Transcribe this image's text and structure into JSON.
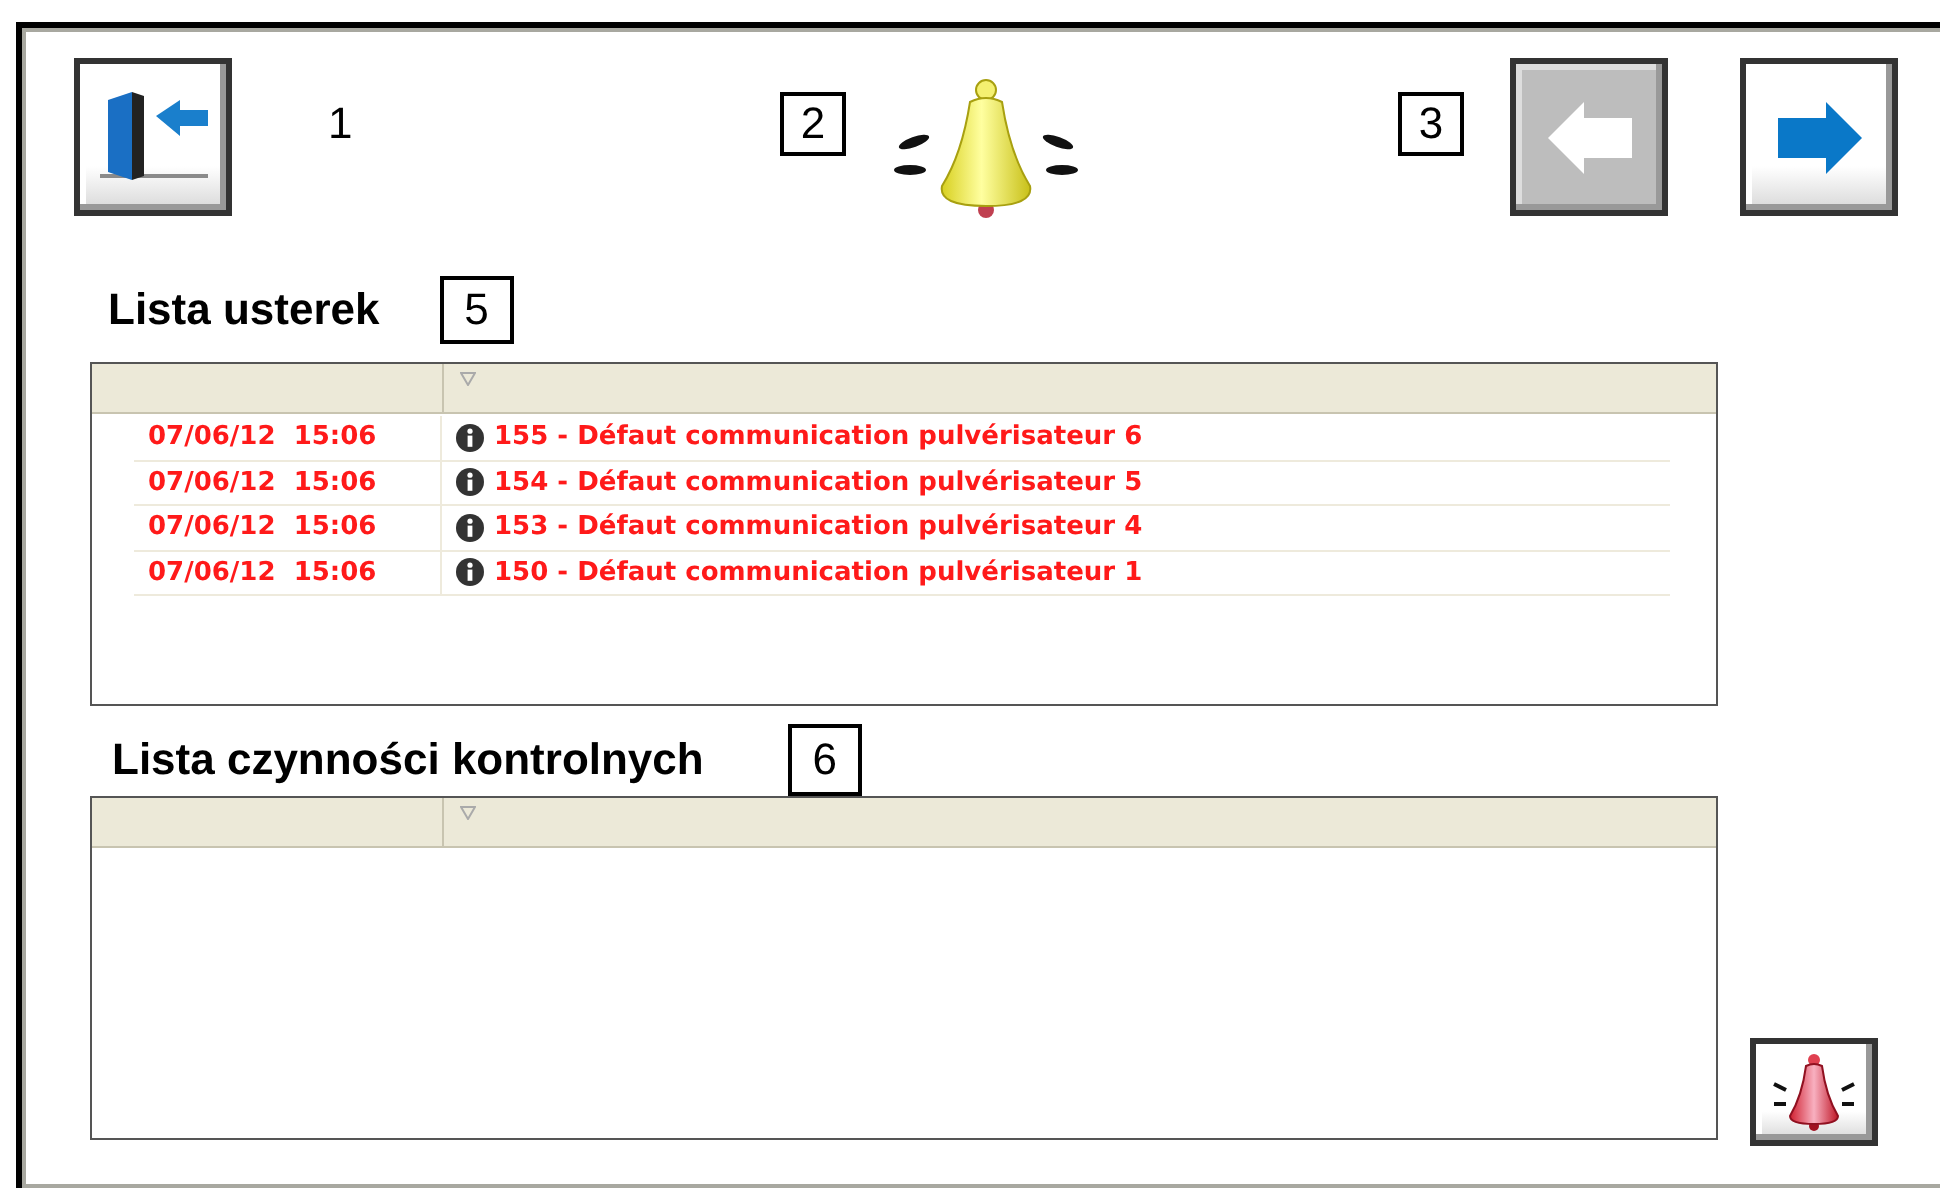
{
  "toolbar": {
    "exit_button": {
      "disabled": false
    },
    "labels": [
      "1",
      "2",
      "3"
    ],
    "back_button": {
      "disabled": true
    },
    "forward_button": {
      "disabled": false
    }
  },
  "faults": {
    "title": "Lista usterek",
    "marker": "5",
    "rows": [
      {
        "timestamp": "07/06/12  15:06",
        "message": "155 - Défaut communication pulvérisateur 6"
      },
      {
        "timestamp": "07/06/12  15:06",
        "message": "154 - Défaut communication pulvérisateur 5"
      },
      {
        "timestamp": "07/06/12  15:06",
        "message": "153 - Défaut communication pulvérisateur 4"
      },
      {
        "timestamp": "07/06/12  15:06",
        "message": "150 - Défaut communication pulvérisateur 1"
      }
    ]
  },
  "checks": {
    "title": "Lista czynności kontrolnych",
    "marker": "6"
  }
}
